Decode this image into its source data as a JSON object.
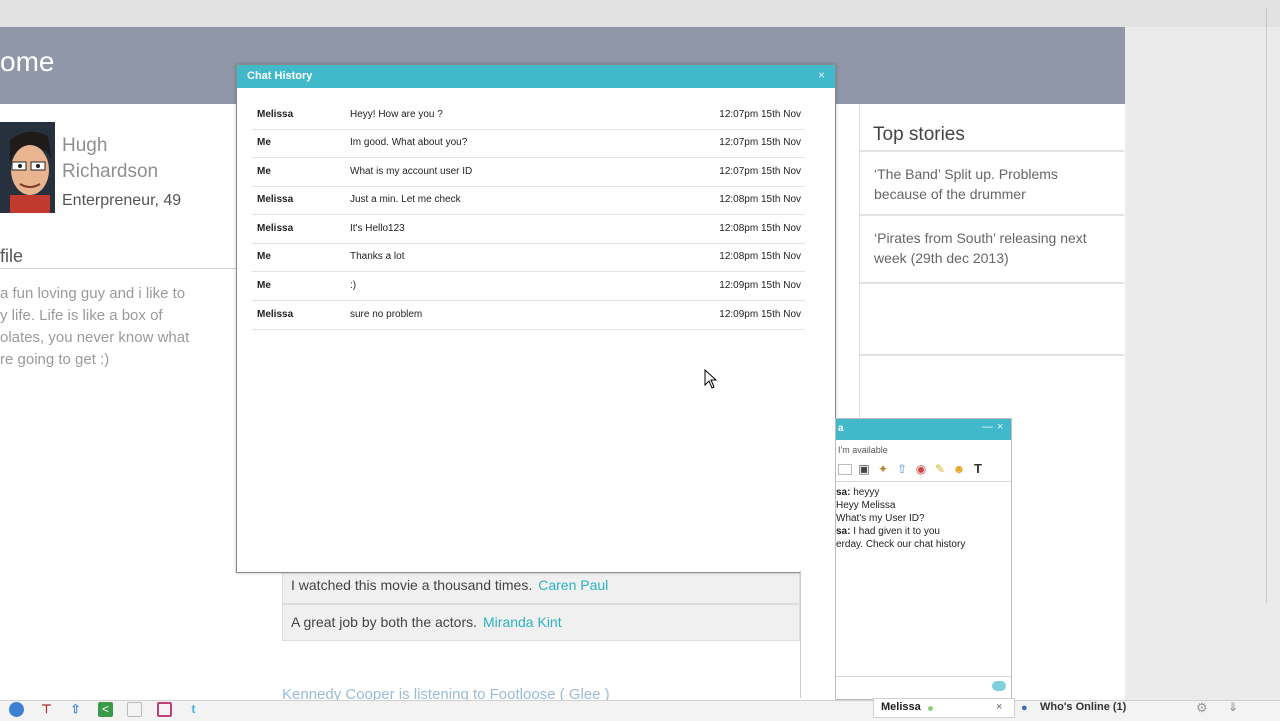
{
  "header": {
    "title": "ome"
  },
  "profile": {
    "first_name": "Hugh",
    "last_name": "Richardson",
    "role": "Enterpreneur, 49",
    "section_heading": "file",
    "bio": "a fun loving guy and i like to\ny life. Life is like a box of\nolates, you never know what\nre going to get :)"
  },
  "stories": {
    "heading": "Top stories",
    "items": [
      {
        "title": "‘The Band’ Split up. Problems because of the drummer"
      },
      {
        "title": "‘Pirates from South’ releasing next week (29th dec 2013)"
      }
    ]
  },
  "comments": [
    {
      "text": "I watched this movie a thousand times.",
      "author": "Caren Paul"
    },
    {
      "text": "A great job by both the actors.",
      "author": "Miranda Kint"
    }
  ],
  "activity": {
    "text": "Kennedy Cooper is listening to Footloose ( Glee )"
  },
  "chat_history": {
    "title": "Chat History",
    "close_label": "×",
    "messages": [
      {
        "sender": "Melissa",
        "text": "Heyy! How are you ?",
        "time": "12:07pm 15th Nov"
      },
      {
        "sender": "Me",
        "text": "Im good. What about you?",
        "time": "12:07pm 15th Nov"
      },
      {
        "sender": "Me",
        "text": "What is my account user ID",
        "time": "12:07pm 15th Nov"
      },
      {
        "sender": "Melissa",
        "text": "Just a min. Let me check",
        "time": "12:08pm 15th Nov"
      },
      {
        "sender": "Melissa",
        "text": "It's Hello123",
        "time": "12:08pm 15th Nov"
      },
      {
        "sender": "Me",
        "text": "Thanks a lot",
        "time": "12:08pm 15th Nov"
      },
      {
        "sender": "Me",
        "text": ":)",
        "time": "12:09pm 15th Nov"
      },
      {
        "sender": "Melissa",
        "text": "sure no problem",
        "time": "12:09pm 15th Nov"
      }
    ]
  },
  "chat_window": {
    "name_fragment": "a",
    "minimize_label": "—",
    "close_label": "×",
    "status": "I'm available",
    "tools": [
      "window-icon",
      "save-icon",
      "broom-icon",
      "upload-icon",
      "record-icon",
      "pencil-icon",
      "emoticon-icon",
      "text-format-icon"
    ],
    "lines": [
      {
        "prefix": "sa:",
        "text": " heyyy"
      },
      {
        "prefix": "",
        "text": "Heyy Melissa"
      },
      {
        "prefix": "",
        "text": "What's my User ID?"
      },
      {
        "prefix": "sa:",
        "text": " I had given it to you"
      },
      {
        "prefix": "",
        "text": "erday. Check our chat history"
      }
    ]
  },
  "bottom_bar": {
    "icons": [
      "globe-icon",
      "stamp-icon",
      "arrow-up-icon",
      "share-icon",
      "card-icon",
      "square-icon",
      "twitter-icon"
    ],
    "tab": {
      "name": "Melissa",
      "close_label": "×"
    },
    "online": {
      "label": "Who's Online (1)"
    }
  },
  "colors": {
    "accent": "#42b9ca",
    "link": "#2bb3c0",
    "header": "#8f97a8"
  }
}
